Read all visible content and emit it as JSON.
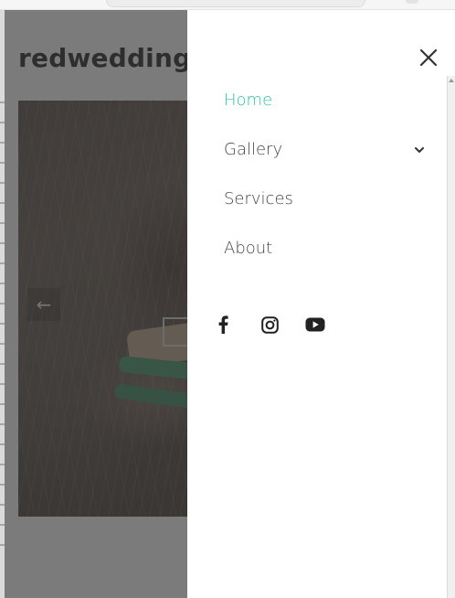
{
  "site": {
    "brand": "redwedding",
    "hero": {
      "prev_arrow": "←"
    }
  },
  "drawer": {
    "close_icon": "close-icon",
    "nav": [
      {
        "label": "Home",
        "active": true
      },
      {
        "label": "Gallery",
        "has_dropdown": true,
        "dropdown_icon": "chevron-down-icon"
      },
      {
        "label": "Services"
      },
      {
        "label": "About"
      }
    ],
    "social": [
      {
        "icon": "facebook-icon"
      },
      {
        "icon": "instagram-icon"
      },
      {
        "icon": "youtube-icon"
      }
    ]
  },
  "colors": {
    "accent": "#2ec3a0",
    "nav_text": "#444444",
    "brand_text": "#111111",
    "overlay": "rgba(60,60,60,0.68)"
  }
}
